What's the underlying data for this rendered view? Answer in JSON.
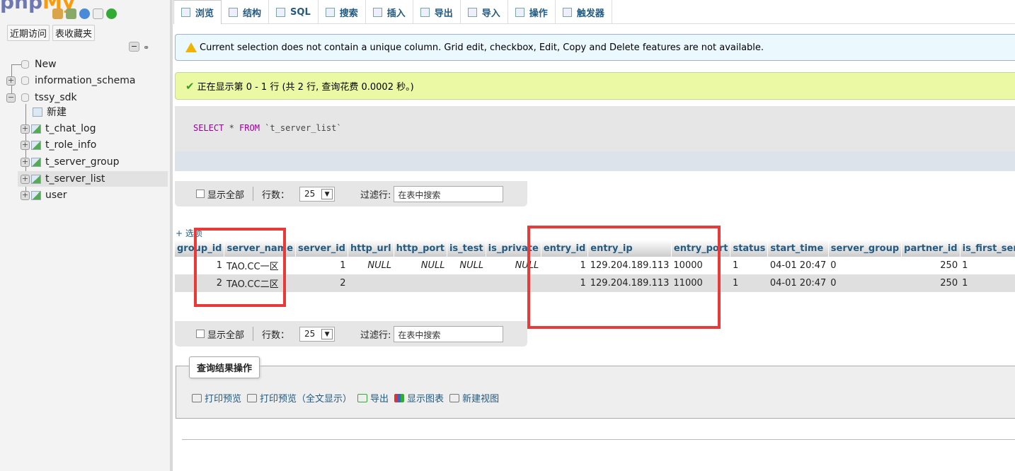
{
  "sidebar": {
    "logo": "phpMyAdmin",
    "nav_buttons": [
      "近期访问",
      "表收藏夹"
    ],
    "tree": [
      {
        "label": "New",
        "type": "new"
      },
      {
        "label": "information_schema",
        "type": "db"
      },
      {
        "label": "tssy_sdk",
        "type": "db",
        "expanded": true
      },
      {
        "label": "新建",
        "type": "new-table"
      },
      {
        "label": "t_chat_log",
        "type": "table"
      },
      {
        "label": "t_role_info",
        "type": "table"
      },
      {
        "label": "t_server_group",
        "type": "table"
      },
      {
        "label": "t_server_list",
        "type": "table",
        "selected": true
      },
      {
        "label": "user",
        "type": "table"
      }
    ]
  },
  "tabs": [
    {
      "label": "浏览",
      "icon": "browse-icon",
      "active": true
    },
    {
      "label": "结构",
      "icon": "structure-icon"
    },
    {
      "label": "SQL",
      "icon": "sql-icon"
    },
    {
      "label": "搜索",
      "icon": "search-icon"
    },
    {
      "label": "插入",
      "icon": "insert-icon"
    },
    {
      "label": "导出",
      "icon": "export-icon"
    },
    {
      "label": "导入",
      "icon": "import-icon"
    },
    {
      "label": "操作",
      "icon": "wrench-icon"
    },
    {
      "label": "触发器",
      "icon": "trigger-icon"
    }
  ],
  "notice": "Current selection does not contain a unique column. Grid edit, checkbox, Edit, Copy and Delete features are not available.",
  "success": "正在显示第 0 - 1 行 (共 2 行, 查询花费 0.0002 秒。)",
  "sql": {
    "select": "SELECT",
    "rest1": " * ",
    "from": "FROM",
    "rest2": " `t_server_list`"
  },
  "navbar": {
    "show_all": "显示全部",
    "rows_label": "行数：",
    "rows_value": "25",
    "filter_label": "过滤行:",
    "filter_placeholder": "在表中搜索"
  },
  "options_link": "+ 选项",
  "columns": [
    "group_id",
    "server_name",
    "server_id",
    "http_url",
    "http_port",
    "is_test",
    "is_private",
    "entry_id",
    "entry_ip",
    "entry_port",
    "status",
    "start_time",
    "server_group",
    "partner_id",
    "is_first_ser"
  ],
  "rows": [
    [
      "1",
      "TAO.CC一区",
      "1",
      "NULL",
      "NULL",
      "NULL",
      "NULL",
      "1",
      "129.204.189.113",
      "10000",
      "1",
      "04-01 20:47",
      "0",
      "250",
      "1"
    ],
    [
      "2",
      "TAO.CC二区",
      "2",
      "",
      "",
      "",
      "",
      "1",
      "129.204.189.113",
      "11000",
      "1",
      "04-01 20:47",
      "0",
      "250",
      "1"
    ]
  ],
  "query_ops": {
    "legend": "查询结果操作",
    "links": [
      "打印预览",
      "打印预览（全文显示）",
      "导出",
      "显示图表",
      "新建视图"
    ]
  },
  "colors": {
    "link": "#235a81",
    "highlight_box": "#e93a3a",
    "success_bg": "#ebf8a4",
    "notice_bg": "#ebf8fd"
  }
}
